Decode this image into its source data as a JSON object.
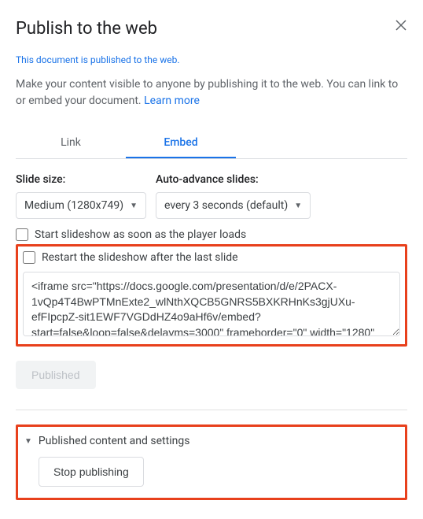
{
  "dialog": {
    "title": "Publish to the web",
    "status_text": "This document is published to the web.",
    "description": "Make your content visible to anyone by publishing it to the web. You can link to or embed your document. ",
    "learn_more": "Learn more"
  },
  "tabs": {
    "link": "Link",
    "embed": "Embed"
  },
  "controls": {
    "slide_size_label": "Slide size:",
    "slide_size_value": "Medium (1280x749)",
    "auto_advance_label": "Auto-advance slides:",
    "auto_advance_value": "every 3 seconds (default)",
    "checkbox_start": "Start slideshow as soon as the player loads",
    "checkbox_restart": "Restart the slideshow after the last slide"
  },
  "embed": {
    "code": "<iframe src=\"https://docs.google.com/presentation/d/e/2PACX-1vQp4T4BwPTMnExte2_wlNthXQCB5GNRS5BXKRHnKs3gjUXu-efFIpcpZ-sit1EWF7VGDdHZ4o9aHf6v/embed?start=false&loop=false&delayms=3000\" frameborder=\"0\" width=\"1280\""
  },
  "buttons": {
    "published": "Published",
    "stop_publishing": "Stop publishing"
  },
  "expander": {
    "label": "Published content and settings"
  }
}
